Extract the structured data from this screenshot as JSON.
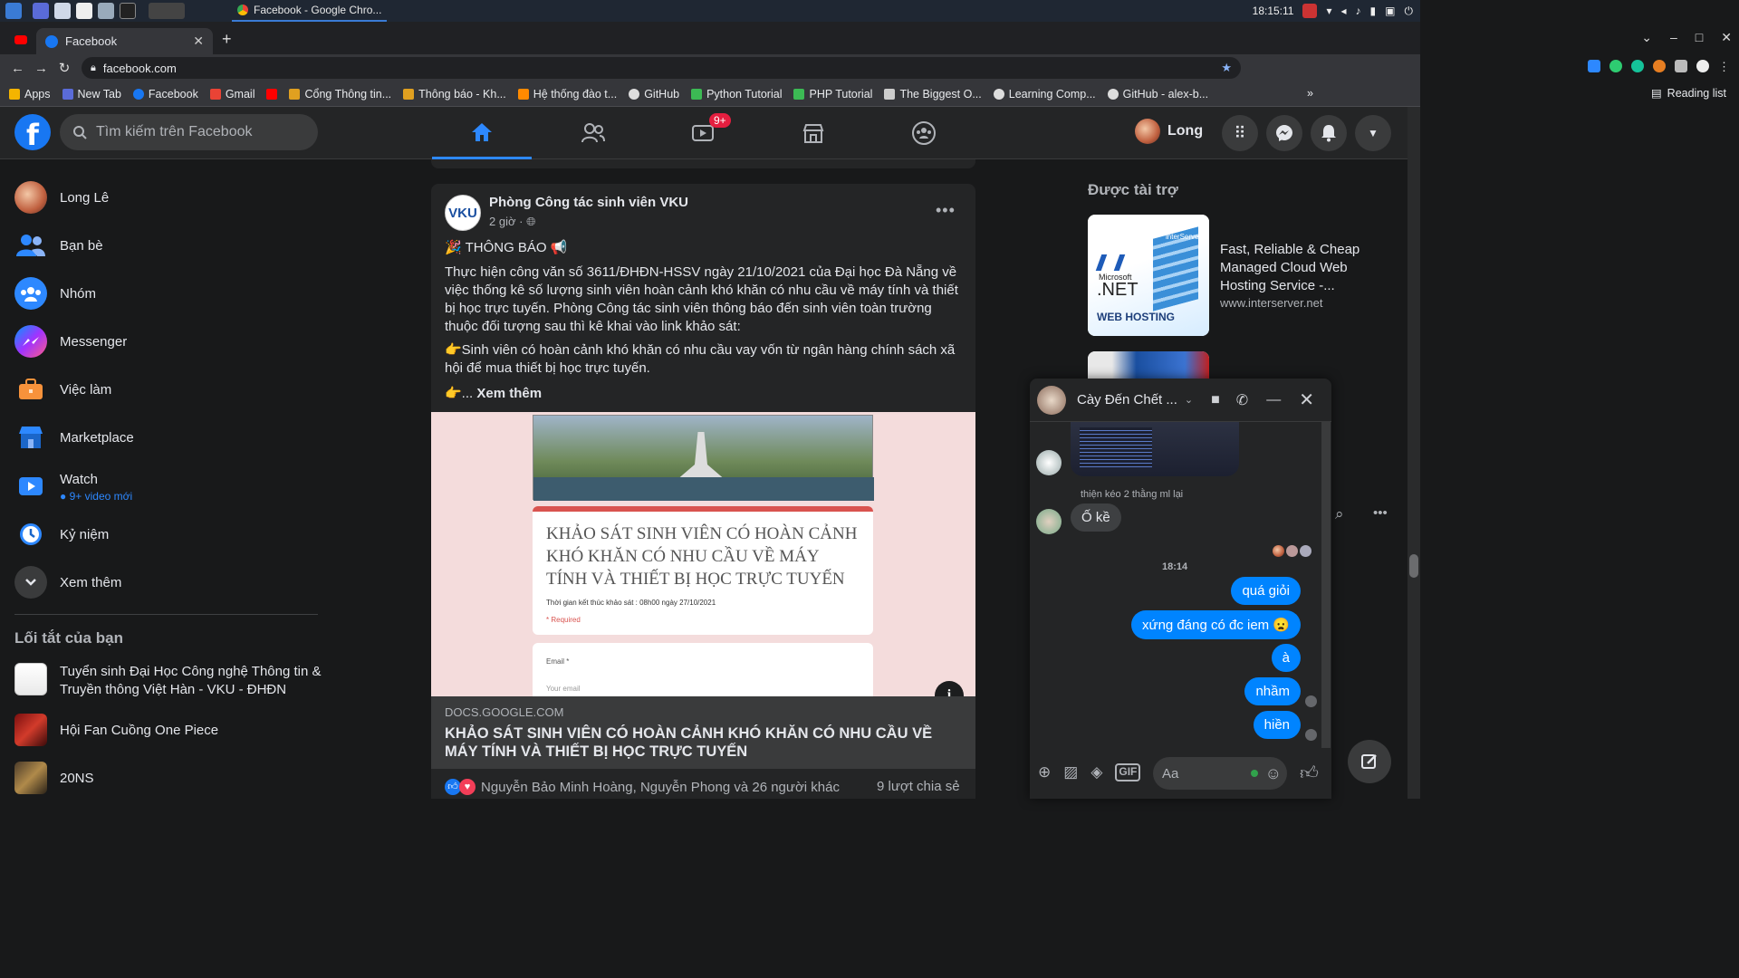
{
  "os": {
    "clock": "18:15:11",
    "task_title": "Facebook - Google Chro..."
  },
  "browser": {
    "tab_title": "Facebook",
    "url": "facebook.com",
    "reading_list": "Reading list",
    "bookmarks": [
      {
        "label": "Apps",
        "color": "#f4b400"
      },
      {
        "label": "New Tab",
        "color": "#5a6bd8"
      },
      {
        "label": "Facebook",
        "color": "#1877f2"
      },
      {
        "label": "Gmail",
        "color": "#ea4335"
      },
      {
        "label": "",
        "color": "#ff0000"
      },
      {
        "label": "Cổng Thông tin...",
        "color": "#e0a020"
      },
      {
        "label": "Thông báo - Kh...",
        "color": "#e0a020"
      },
      {
        "label": "Hệ thống đào t...",
        "color": "#ff8a00"
      },
      {
        "label": "GitHub",
        "color": "#dddddd"
      },
      {
        "label": "Python Tutorial",
        "color": "#3cba54"
      },
      {
        "label": "PHP Tutorial",
        "color": "#3cba54"
      },
      {
        "label": "The Biggest O...",
        "color": "#cccccc"
      },
      {
        "label": "Learning Comp...",
        "color": "#dddddd"
      },
      {
        "label": "GitHub - alex-b...",
        "color": "#dddddd"
      }
    ]
  },
  "fb": {
    "search_placeholder": "Tìm kiếm trên Facebook",
    "watch_badge": "9+",
    "profile_name": "Long",
    "sidebar": [
      {
        "label": "Long Lê",
        "icon": "profile-avatar"
      },
      {
        "label": "Bạn bè",
        "icon": "friends-icon"
      },
      {
        "label": "Nhóm",
        "icon": "groups-icon"
      },
      {
        "label": "Messenger",
        "icon": "messenger-icon"
      },
      {
        "label": "Việc làm",
        "icon": "jobs-icon"
      },
      {
        "label": "Marketplace",
        "icon": "marketplace-icon"
      },
      {
        "label": "Watch",
        "icon": "watch-icon",
        "sub": "9+ video mới"
      },
      {
        "label": "Kỷ niệm",
        "icon": "memories-icon"
      },
      {
        "label": "Xem thêm",
        "icon": "chevron-down-icon"
      }
    ],
    "shortcuts_title": "Lối tắt của bạn",
    "shortcuts": [
      {
        "label": "Tuyển sinh Đại Học Công nghệ Thông tin & Truyền thông Việt Hàn - VKU - ĐHĐN"
      },
      {
        "label": "Hội Fan Cuồng One Piece"
      },
      {
        "label": "20NS"
      }
    ],
    "post": {
      "author": "Phòng Công tác sinh viên VKU",
      "avatar_text": "VKU",
      "time": "2 giờ ·",
      "heading": "🎉 THÔNG BÁO 📢",
      "body": "Thực hiện công văn số 3611/ĐHĐN-HSSV ngày 21/10/2021 của Đại học Đà Nẵng về việc thống kê số lượng sinh viên hoàn cảnh khó khăn có nhu cầu về máy tính và thiết bị học trực tuyến. Phòng Công tác sinh viên thông báo đến sinh viên toàn trường thuộc đối tượng sau thì kê khai vào link khảo sát:",
      "bullet": "👉Sinh viên có hoàn cảnh khó khăn có nhu cầu vay vốn từ ngân hàng chính sách xã hội để mua thiết bị học trực tuyến.",
      "see_more_prefix": "👉... ",
      "see_more": "Xem thêm",
      "form_title": "KHẢO SÁT SINH VIÊN CÓ HOÀN CẢNH KHÓ KHĂN CÓ NHU CẦU VỀ MÁY TÍNH VÀ THIẾT BỊ HỌC TRỰC TUYẾN",
      "form_deadline": "Thời gian kết thúc khảo sát : 08h00 ngày 27/10/2021",
      "form_required": "* Required",
      "form_email": "Email *",
      "form_email_ph": "Your email",
      "link_domain": "DOCS.GOOGLE.COM",
      "link_title": "KHẢO SÁT SINH VIÊN CÓ HOÀN CẢNH KHÓ KHĂN CÓ NHU CẦU VỀ MÁY TÍNH VÀ THIẾT BỊ HỌC TRỰC TUYẾN",
      "reactions_text": "Nguyễn Bảo Minh Hoàng, Nguyễn Phong và 26 người khác",
      "shares": "9 lượt chia sẻ"
    },
    "sponsored": {
      "title": "Được tài trợ",
      "ad_title": "Fast, Reliable & Cheap Managed Cloud Web Hosting Service -...",
      "ad_url": "www.interserver.net",
      "ad_img_text1": "Microsoft",
      "ad_img_text2": ".NET",
      "ad_img_text3": "WEB HOSTING",
      "ad_img_brand": "interServer"
    },
    "chat": {
      "title": "Cày Đến Chết ...",
      "meta": "thiện kéo 2 thằng ml lại",
      "incoming": "Ố kề",
      "time": "18:14",
      "outgoing": [
        "quá giỏi",
        "xứng đáng có đc iem 😦",
        "à",
        "nhầm",
        "hiền"
      ],
      "input_placeholder": "Aa"
    }
  }
}
